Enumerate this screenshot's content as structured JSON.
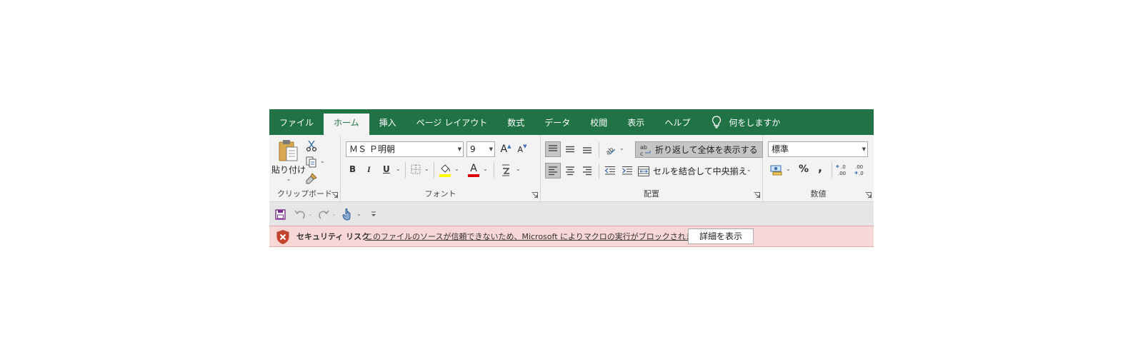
{
  "tabs": [
    {
      "label": "ファイル"
    },
    {
      "label": "ホーム"
    },
    {
      "label": "挿入"
    },
    {
      "label": "ページ レイアウト"
    },
    {
      "label": "数式"
    },
    {
      "label": "データ"
    },
    {
      "label": "校閲"
    },
    {
      "label": "表示"
    },
    {
      "label": "ヘルプ"
    }
  ],
  "active_tab": "ホーム",
  "tell_me": "何をしますか",
  "ribbon": {
    "clipboard": {
      "paste_label": "貼り付け",
      "group_label": "クリップボード"
    },
    "font": {
      "font_name": "ＭＳ Ｐ明朝",
      "font_size": "9",
      "bold": "B",
      "italic": "I",
      "underline": "U",
      "increase_size": "A",
      "decrease_size": "A",
      "font_color_glyph": "A",
      "group_label": "フォント"
    },
    "alignment": {
      "wrap_text": "折り返して全体を表示する",
      "merge_center": "セルを結合して中央揃え",
      "group_label": "配置"
    },
    "number": {
      "format": "標準",
      "percent": "%",
      "comma": ",",
      "group_label": "数値"
    }
  },
  "security_bar": {
    "title": "セキュリティ リスク",
    "message": "このファイルのソースが信頼できないため、Microsoft によりマクロの実行がブロックされました。",
    "button": "詳細を表示"
  },
  "colors": {
    "excel_green": "#217346",
    "ribbon_bg": "#f3f3f3",
    "qat_bg": "#e6e6e6",
    "security_bg": "#f8d7d7",
    "highlight_yellow": "#ffff00",
    "font_red": "#e00000"
  }
}
